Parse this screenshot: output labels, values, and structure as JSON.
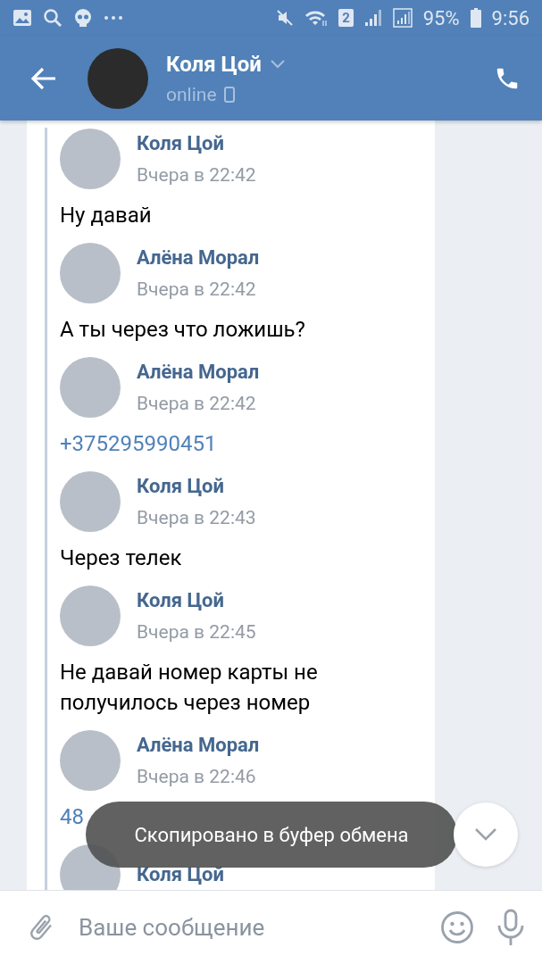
{
  "status_bar": {
    "sim_badge": "2",
    "battery": "95%",
    "time": "9:56"
  },
  "header": {
    "title": "Коля Цой",
    "subtitle": "online"
  },
  "messages": [
    {
      "name": "Коля Цой",
      "time": "Вчера в 22:42",
      "text": "Ну давай",
      "kind": "text"
    },
    {
      "name": "Алёна Морал",
      "time": "Вчера в 22:42",
      "text": "А ты через что ложишь?",
      "kind": "text"
    },
    {
      "name": "Алёна Морал",
      "time": "Вчера в 22:42",
      "text": "+375295990451",
      "kind": "link"
    },
    {
      "name": "Коля Цой",
      "time": "Вчера в 22:43",
      "text": "Через телек",
      "kind": "text"
    },
    {
      "name": "Коля Цой",
      "time": "Вчера в 22:45",
      "text": "Не давай номер карты не получилось через номер",
      "kind": "text"
    },
    {
      "name": "Алёна Морал",
      "time": "Вчера в 22:46",
      "text": "48",
      "kind": "link"
    },
    {
      "name": "Коля Цой",
      "kind": "text"
    }
  ],
  "toast": "Скопировано в буфер обмена",
  "composer": {
    "placeholder": "Ваше сообщение"
  }
}
